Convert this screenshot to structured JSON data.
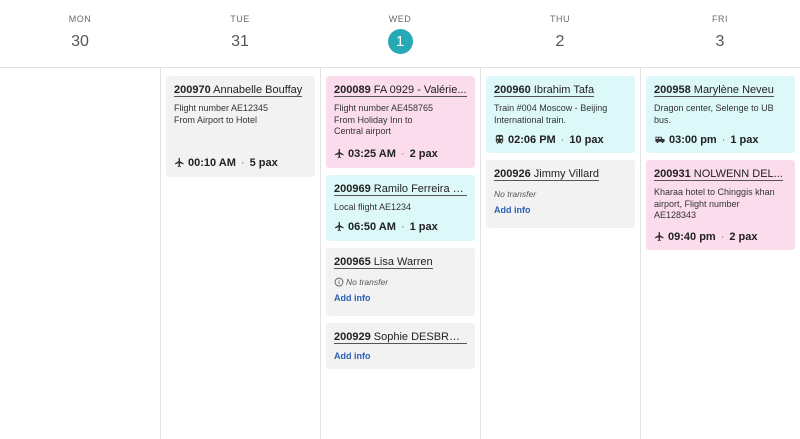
{
  "days": [
    {
      "name": "MON",
      "num": "30"
    },
    {
      "name": "TUE",
      "num": "31"
    },
    {
      "name": "WED",
      "num": "1",
      "today": true
    },
    {
      "name": "THU",
      "num": "2"
    },
    {
      "name": "FRI",
      "num": "3"
    }
  ],
  "events": {
    "tue_1": {
      "id": "200970",
      "name": "Annabelle Bouffay",
      "desc_1": "Flight number AE12345",
      "desc_2": "From Airport to Hotel",
      "icon": "airplane-icon",
      "time": "00:10 AM",
      "sep": "·",
      "pax": "5 pax"
    },
    "wed_1": {
      "id": "200089",
      "name": "FA 0929 - Valérie...",
      "desc_1": "Flight number AE458765",
      "desc_2": "From Holiday Inn to",
      "desc_3": "Central airport",
      "icon": "airplane-icon",
      "time": "03:25 AM",
      "sep": "·",
      "pax": "2 pax",
      "color": "#fbdcec"
    },
    "wed_2": {
      "id": "200969",
      "name": "Ramilo Ferreira d...",
      "desc_1": "Local flight AE1234",
      "icon": "airplane-icon",
      "time": "06:50 AM",
      "sep": "·",
      "pax": "1 pax",
      "color": "#dcf8f9"
    },
    "wed_3": {
      "id": "200965",
      "name": "Lisa Warren",
      "no_transfer": "No transfer",
      "add_info": "Add info"
    },
    "wed_4": {
      "id": "200929",
      "name": "Sophie DESBREST",
      "add_info": "Add info"
    },
    "thu_1": {
      "id": "200960",
      "name": "Ibrahim Tafa",
      "desc_1": "Train #004 Moscow - Beijing",
      "desc_2": "International train.",
      "icon": "train-icon",
      "time": "02:06 PM",
      "sep": "·",
      "pax": "10 pax",
      "color": "#dcf8f9"
    },
    "thu_2": {
      "id": "200926",
      "name": "Jimmy Villard",
      "no_transfer": "No transfer",
      "add_info": "Add info"
    },
    "fri_1": {
      "id": "200958",
      "name": "Marylène Neveu",
      "desc_1": "Dragon center, Selenge to UB",
      "desc_2": "bus.",
      "icon": "bus-icon",
      "time": "03:00 pm",
      "sep": "·",
      "pax": "1 pax",
      "color": "#dcf8f9"
    },
    "fri_2": {
      "id": "200931",
      "name": "NOLWENN DEL...",
      "desc_1": "Kharaa hotel to Chinggis khan",
      "desc_2": "airport, Flight number",
      "desc_3": "AE128343",
      "icon": "airplane-icon",
      "time": "09:40 pm",
      "sep": "·",
      "pax": "2 pax",
      "color": "#fbdcec"
    }
  },
  "colors": {
    "today_accent": "#26a9b4",
    "link": "#2a5db8",
    "card_grey": "#f2f2f2"
  }
}
